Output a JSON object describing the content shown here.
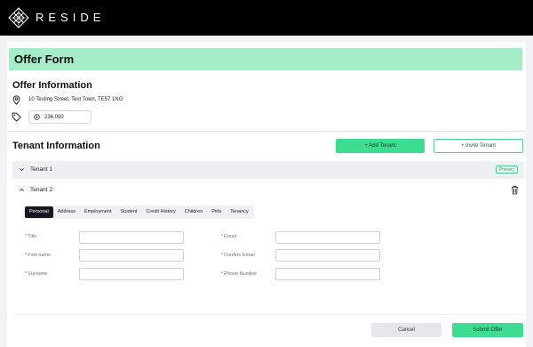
{
  "header": {
    "brand": "RESIDE",
    "logo_icon": "diamond-lattice-logo"
  },
  "form": {
    "title": "Offer Form"
  },
  "offer_info": {
    "heading": "Offer Information",
    "address_icon": "location-pin-icon",
    "address": "10 Testing Street, Test Town, TE57 1NG",
    "price_icon": "tag-icon",
    "currency_icon": "coin-icon",
    "price": "236,000"
  },
  "tenant_info": {
    "heading": "Tenant Information",
    "add_button": "+ Add Tenant",
    "invite_button": "+ Invite Tenant"
  },
  "tenants": [
    {
      "label": "Tenant 1",
      "badge": "Primary",
      "expanded": false
    },
    {
      "label": "Tenant 2",
      "expanded": true
    }
  ],
  "tabs": [
    "Personal",
    "Address",
    "Employment",
    "Student",
    "Credit History",
    "Children",
    "Pets",
    "Tenancy"
  ],
  "active_tab": "Personal",
  "fields": {
    "title": {
      "label": "Title",
      "value": ""
    },
    "first_name": {
      "label": "First name",
      "value": ""
    },
    "surname": {
      "label": "Surname",
      "value": ""
    },
    "email": {
      "label": "Email",
      "value": ""
    },
    "confirm_email": {
      "label": "Confirm Email",
      "value": ""
    },
    "phone": {
      "label": "Phone Number",
      "value": ""
    }
  },
  "footer": {
    "cancel": "Cancel",
    "submit": "Submit Offer"
  },
  "colors": {
    "accent_green": "#3ddc91",
    "title_bar": "#a5ecc8",
    "topbar": "#000000"
  }
}
